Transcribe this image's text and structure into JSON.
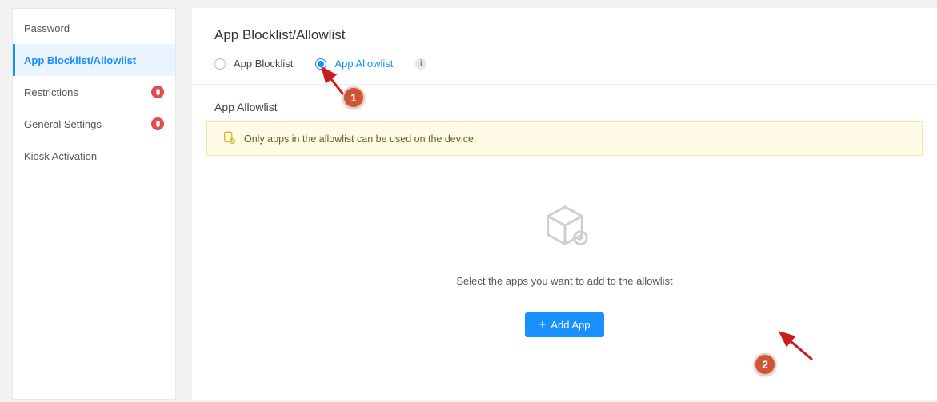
{
  "sidebar": {
    "items": [
      {
        "label": "Password",
        "active": false,
        "badge": false
      },
      {
        "label": "App Blocklist/Allowlist",
        "active": true,
        "badge": false
      },
      {
        "label": "Restrictions",
        "active": false,
        "badge": true
      },
      {
        "label": "General Settings",
        "active": false,
        "badge": true
      },
      {
        "label": "Kiosk Activation",
        "active": false,
        "badge": false
      }
    ]
  },
  "main": {
    "title": "App Blocklist/Allowlist",
    "radios": {
      "blocklist_label": "App Blocklist",
      "allowlist_label": "App Allowlist",
      "info": "i"
    },
    "subtitle": "App Allowlist",
    "notice": "Only apps in the allowlist can be used on the device.",
    "empty_text": "Select the apps you want to add to the allowlist",
    "add_btn_label": "Add App"
  },
  "annotations": {
    "badge1": "1",
    "badge2": "2"
  }
}
